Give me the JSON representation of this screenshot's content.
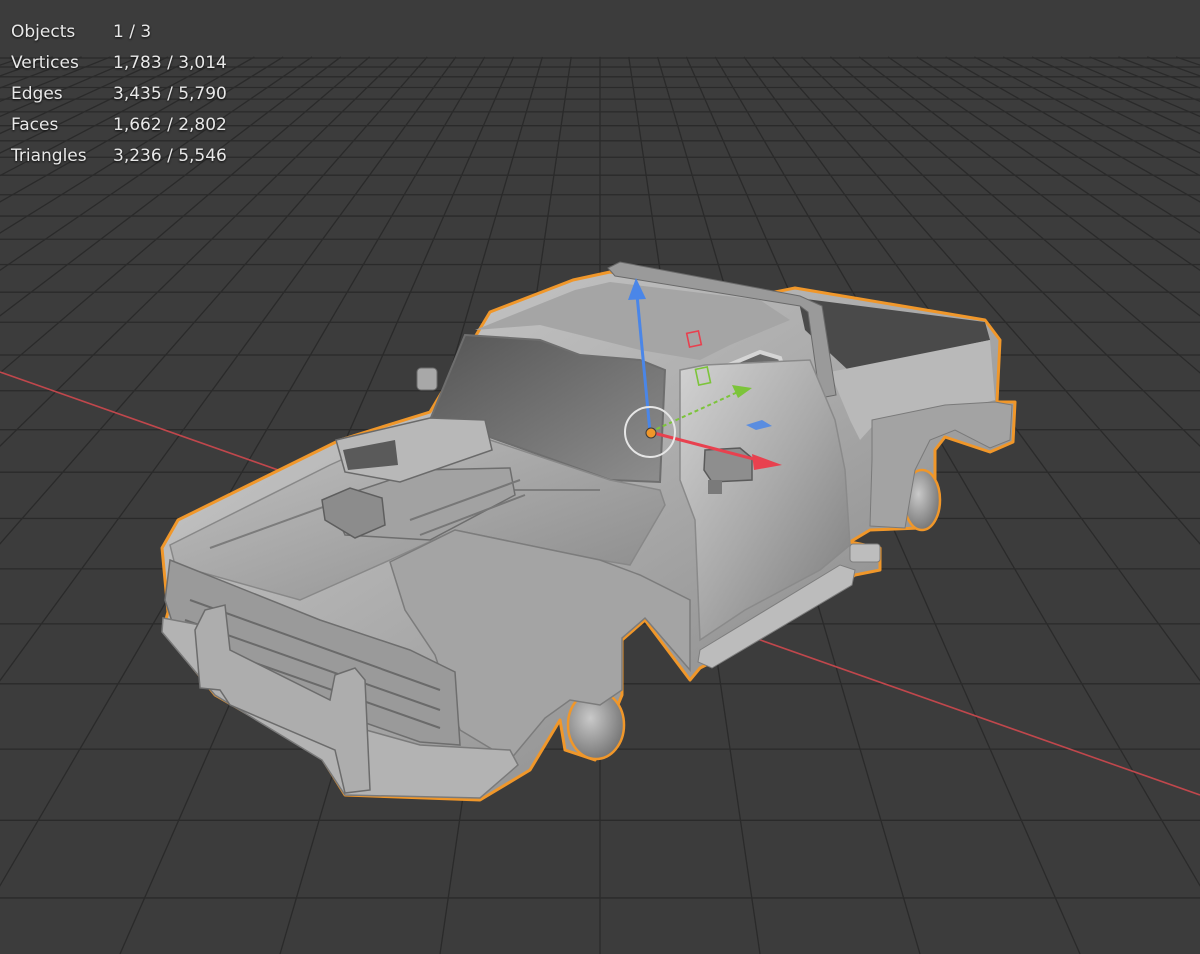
{
  "viewport": {
    "background": "#3c3c3c",
    "grid_color": "#2a2a2a",
    "x_axis_color": "#c0474c",
    "selection_outline": "#f0972a"
  },
  "stats": {
    "objects": {
      "label": "Objects",
      "value": "1 / 3"
    },
    "vertices": {
      "label": "Vertices",
      "value": "1,783 / 3,014"
    },
    "edges": {
      "label": "Edges",
      "value": "3,435 / 5,790"
    },
    "faces": {
      "label": "Faces",
      "value": "1,662 / 2,802"
    },
    "triangles": {
      "label": "Triangles",
      "value": "3,236 / 5,546"
    }
  },
  "gizmo": {
    "z_axis_color": "#4a86e8",
    "y_axis_color": "#7cc43a",
    "x_axis_color": "#e8414f",
    "origin_color": "#f0972a"
  },
  "object": {
    "icon": "pickup-truck-mesh",
    "selected": true
  }
}
